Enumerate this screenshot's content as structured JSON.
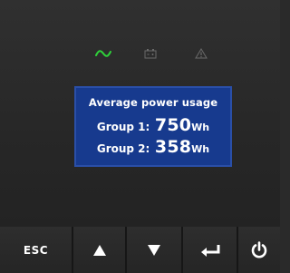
{
  "display": {
    "title": "Average power usage",
    "groups": [
      {
        "label": "Group 1:",
        "value": "750",
        "unit": "Wh"
      },
      {
        "label": "Group 2:",
        "value": "358",
        "unit": "Wh"
      }
    ]
  },
  "indicators": [
    {
      "name": "ac-power-icon",
      "color": "#2fd23a",
      "active": true
    },
    {
      "name": "battery-icon",
      "color": "#6a6a6a",
      "active": false
    },
    {
      "name": "warning-icon",
      "color": "#6a6a6a",
      "active": false
    }
  ],
  "keypad": {
    "esc_label": "ESC",
    "up_icon": "up-arrow-icon",
    "down_icon": "down-arrow-icon",
    "enter_icon": "enter-icon",
    "power_icon": "power-icon"
  },
  "colors": {
    "lcd_background": "#173a8e",
    "lcd_text": "#ffffff",
    "panel": "#2a2a2a",
    "ac_indicator_on": "#2fd23a"
  }
}
